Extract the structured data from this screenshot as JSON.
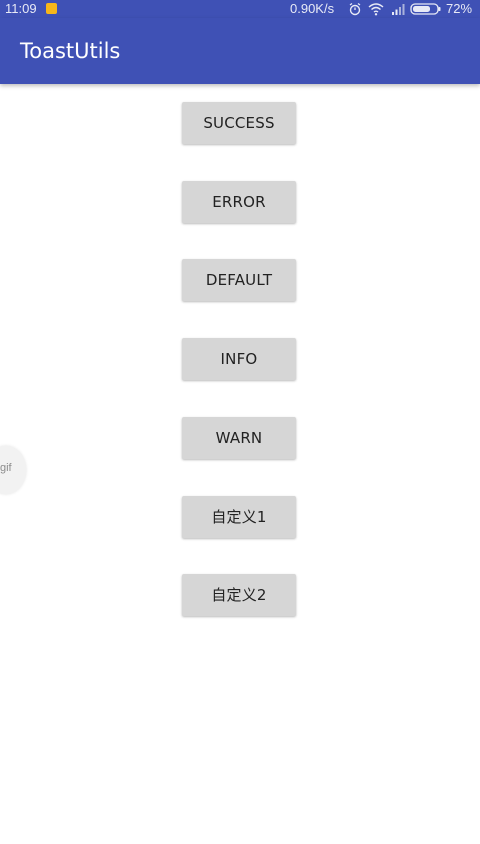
{
  "status_bar": {
    "time": "11:09",
    "network_speed": "0.90K/s",
    "battery_percent": "72%",
    "icons": [
      "notification-icon",
      "alarm-icon",
      "wifi-icon",
      "signal-icon",
      "battery-icon"
    ]
  },
  "app_bar": {
    "title": "ToastUtils",
    "color": "#3f51b5"
  },
  "buttons": [
    {
      "label": "SUCCESS"
    },
    {
      "label": "ERROR"
    },
    {
      "label": "DEFAULT"
    },
    {
      "label": "INFO"
    },
    {
      "label": "WARN"
    },
    {
      "label": "自定义1"
    },
    {
      "label": "自定义2"
    }
  ],
  "floating_ball": {
    "label": "gif"
  }
}
